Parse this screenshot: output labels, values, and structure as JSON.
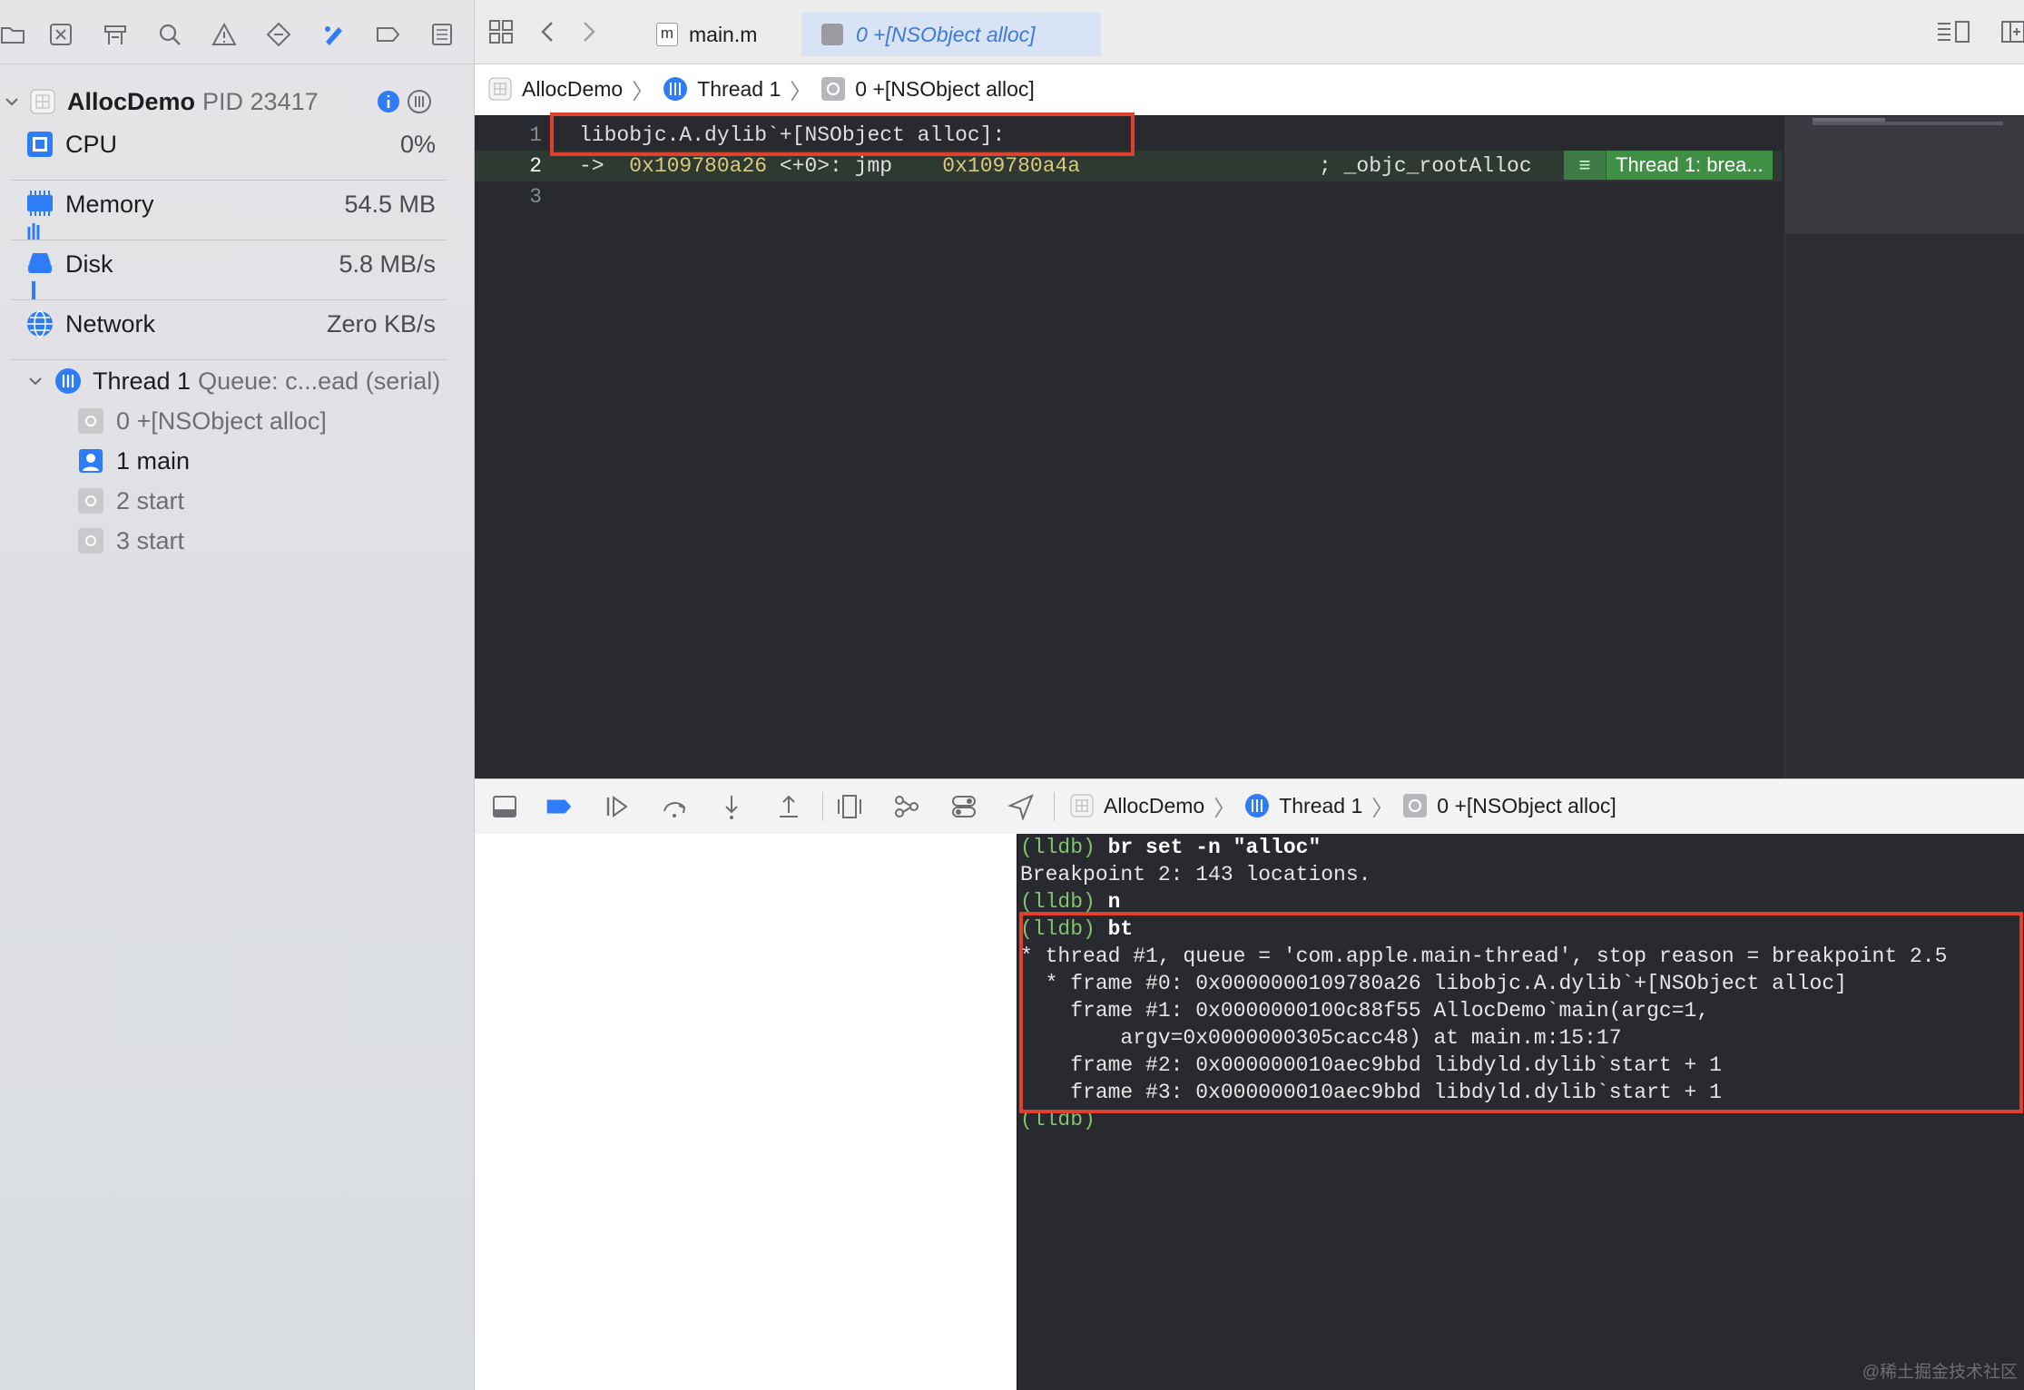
{
  "navigator": {
    "process": {
      "name": "AllocDemo",
      "pid_label": "PID 23417"
    },
    "gauges": [
      {
        "label": "CPU",
        "value": "0%"
      },
      {
        "label": "Memory",
        "value": "54.5 MB"
      },
      {
        "label": "Disk",
        "value": "5.8 MB/s"
      },
      {
        "label": "Network",
        "value": "Zero KB/s"
      }
    ],
    "thread": {
      "name": "Thread 1",
      "queue": "Queue: c...ead (serial)"
    },
    "frames": [
      "0 +[NSObject alloc]",
      "1 main",
      "2 start",
      "3 start"
    ]
  },
  "tabs": {
    "file_tab": "main.m",
    "active_tab": "0 +[NSObject alloc]",
    "file_badge": "m"
  },
  "breadcrumb": [
    "AllocDemo",
    "Thread 1",
    "0 +[NSObject alloc]"
  ],
  "editor": {
    "lines": [
      {
        "num": "1",
        "text": "libobjc.A.dylib`+[NSObject alloc]:"
      },
      {
        "num": "2",
        "arrow": "->",
        "addr": "0x109780a26",
        "mid": " <+0>: jmp    ",
        "target": "0x109780a4a",
        "comment": "; _objc_rootAlloc"
      },
      {
        "num": "3",
        "text": ""
      }
    ],
    "thread_badge": "Thread 1: brea...",
    "badge_icon": "≡"
  },
  "debug_breadcrumb": [
    "AllocDemo",
    "Thread 1",
    "0 +[NSObject alloc]"
  ],
  "console": {
    "lines": [
      {
        "prompt": "(lldb)",
        "cmd": " br set -n \"alloc\""
      },
      {
        "text": "Breakpoint 2: 143 locations."
      },
      {
        "prompt": "(lldb)",
        "cmd": " n"
      },
      {
        "prompt": "(lldb)",
        "cmd": " bt"
      },
      {
        "text": "* thread #1, queue = 'com.apple.main-thread', stop reason = breakpoint 2.5"
      },
      {
        "text": "  * frame #0: 0x0000000109780a26 libobjc.A.dylib`+[NSObject alloc]"
      },
      {
        "text": "    frame #1: 0x0000000100c88f55 AllocDemo`main(argc=1,"
      },
      {
        "text": "        argv=0x0000000305cacc48) at main.m:15:17"
      },
      {
        "text": "    frame #2: 0x000000010aec9bbd libdyld.dylib`start + 1"
      },
      {
        "text": "    frame #3: 0x000000010aec9bbd libdyld.dylib`start + 1"
      },
      {
        "prompt": "(lldb)",
        "cmd": ""
      }
    ]
  },
  "watermark": "@稀土掘金技术社区"
}
